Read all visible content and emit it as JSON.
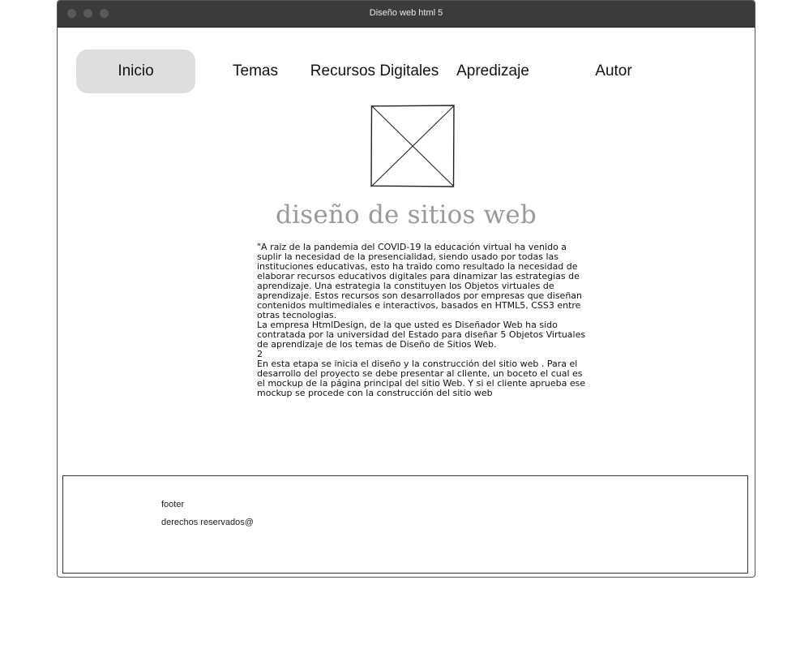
{
  "window": {
    "title": "Diseño web html 5",
    "controls": [
      "close-dot",
      "minimize-dot",
      "maximize-dot"
    ]
  },
  "nav": {
    "items": [
      {
        "label": "Inicio",
        "active": true
      },
      {
        "label": "Temas",
        "active": false
      },
      {
        "label": "Recursos Digitales",
        "active": false
      },
      {
        "label": "Apredizaje",
        "active": false
      },
      {
        "label": "Autor",
        "active": false
      }
    ],
    "active_bg": "#dedede"
  },
  "hero": {
    "image_icon": "image-placeholder-icon",
    "heading": "diseño de sitios web",
    "heading_color": "#9a9a9a"
  },
  "content": {
    "paragraphs": [
      "\"A raiz de la pandemia del COVID-19 la educación virtual ha venido a suplir la necesidad de la presencialidad, siendo usado por todas las instituciones educativas, esto ha traido como resultado la necesidad de elaborar recursos educativos digitales para dinamizar las estrategias de aprendizaje. Una estrategia la constituyen los Objetos virtuales de aprendizaje. Estos recursos son desarrollados por empresas que diseñan contenidos multimediales e interactivos, basados en HTML5, CSS3 entre otras tecnologias.",
      "La empresa HtmlDesign, de la que usted es Diseñador Web ha sido contratada por la universidad del Estado para diseñar 5 Objetos Virtuales de aprendizaje de los temas de Diseño de Sitios Web.",
      "2",
      "En esta etapa se inicia el diseño y la construcción del sitio web . Para el desarrollo del proyecto se debe presentar al cliente, un boceto el cual es el mockup de la página principal del sitio Web. Y si el cliente aprueba ese mockup se procede con la construcción del sitio web"
    ]
  },
  "footer": {
    "label": "footer",
    "copyright": "derechos reservados@"
  }
}
